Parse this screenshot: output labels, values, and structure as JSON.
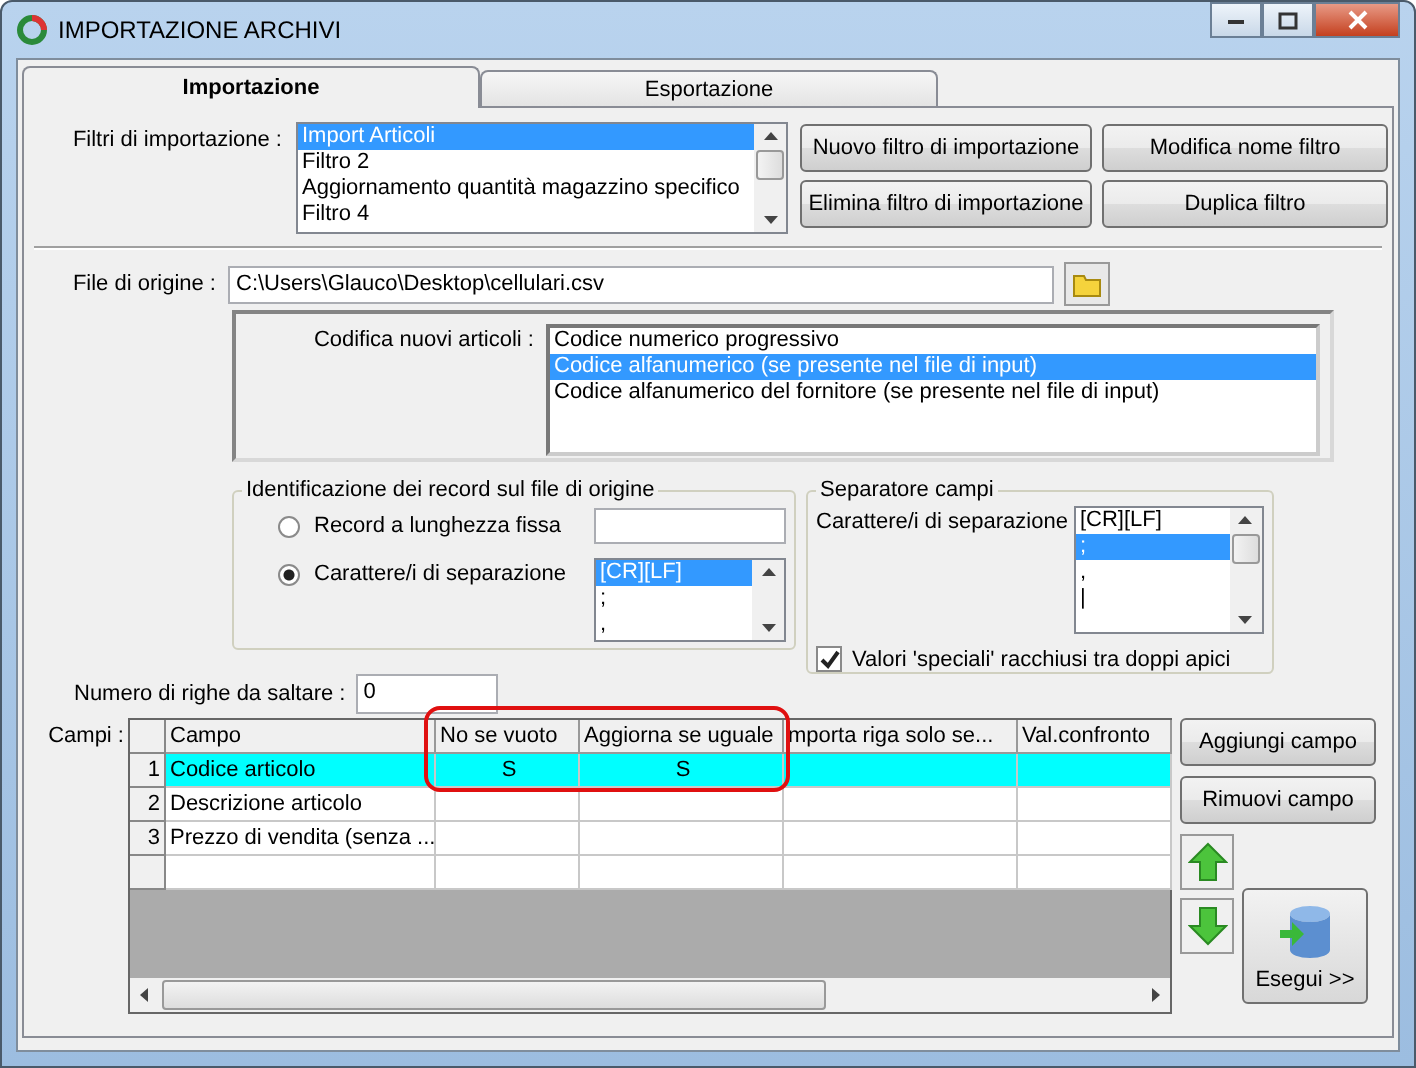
{
  "window": {
    "title": "IMPORTAZIONE ARCHIVI"
  },
  "tabs": [
    {
      "label": "Importazione",
      "selected": true
    },
    {
      "label": "Esportazione",
      "selected": false
    }
  ],
  "filters": {
    "label": "Filtri di importazione :",
    "items": [
      {
        "label": "Import Articoli",
        "selected": true
      },
      {
        "label": "Filtro 2",
        "selected": false
      },
      {
        "label": "Aggiornamento quantità magazzino specifico",
        "selected": false
      },
      {
        "label": "Filtro 4",
        "selected": false
      }
    ]
  },
  "filter_buttons": [
    "Nuovo filtro di importazione",
    "Modifica nome filtro",
    "Elimina filtro di importazione",
    "Duplica filtro"
  ],
  "source_file": {
    "label": "File di origine :",
    "value": "C:\\Users\\Glauco\\Desktop\\cellulari.csv"
  },
  "coding": {
    "label": "Codifica nuovi articoli :",
    "items": [
      {
        "label": "Codice numerico progressivo",
        "selected": false
      },
      {
        "label": "Codice alfanumerico (se presente nel file di input)",
        "selected": true
      },
      {
        "label": "Codice alfanumerico del fornitore (se presente nel file di input)",
        "selected": false
      }
    ]
  },
  "record_id": {
    "title": "Identificazione dei record sul file di origine",
    "options": [
      {
        "label": "Record a lunghezza fissa",
        "selected": false
      },
      {
        "label": "Carattere/i di separazione",
        "selected": true
      }
    ],
    "separators": [
      {
        "label": "[CR][LF]",
        "selected": true
      },
      {
        "label": ";",
        "selected": false
      },
      {
        "label": ",",
        "selected": false
      }
    ]
  },
  "field_separator": {
    "title": "Separatore campi",
    "label": "Carattere/i di separazione",
    "items": [
      {
        "label": "[CR][LF]",
        "selected": false
      },
      {
        "label": ";",
        "selected": true
      },
      {
        "label": ",",
        "selected": false
      },
      {
        "label": "|",
        "selected": false
      }
    ],
    "quoted_values": {
      "label": "Valori 'speciali' racchiusi tra doppi apici",
      "checked": true
    }
  },
  "skip_rows": {
    "label": "Numero di righe da saltare  :",
    "value": "0"
  },
  "fields": {
    "label": "Campi :",
    "columns": [
      "Campo",
      "No se vuoto",
      "Aggiorna se uguale",
      "mporta riga solo se...",
      "Val.confronto"
    ],
    "rows": [
      {
        "number": "1",
        "campo": "Codice articolo",
        "no_se_vuoto": "S",
        "aggiorna": "S",
        "selected": true
      },
      {
        "number": "2",
        "campo": "Descrizione articolo",
        "selected": false
      },
      {
        "number": "3",
        "campo": "Prezzo di vendita (senza ...",
        "selected": false
      }
    ]
  },
  "field_buttons": [
    "Aggiungi campo",
    "Rimuovi campo"
  ],
  "run_button": "Esegui >>"
}
